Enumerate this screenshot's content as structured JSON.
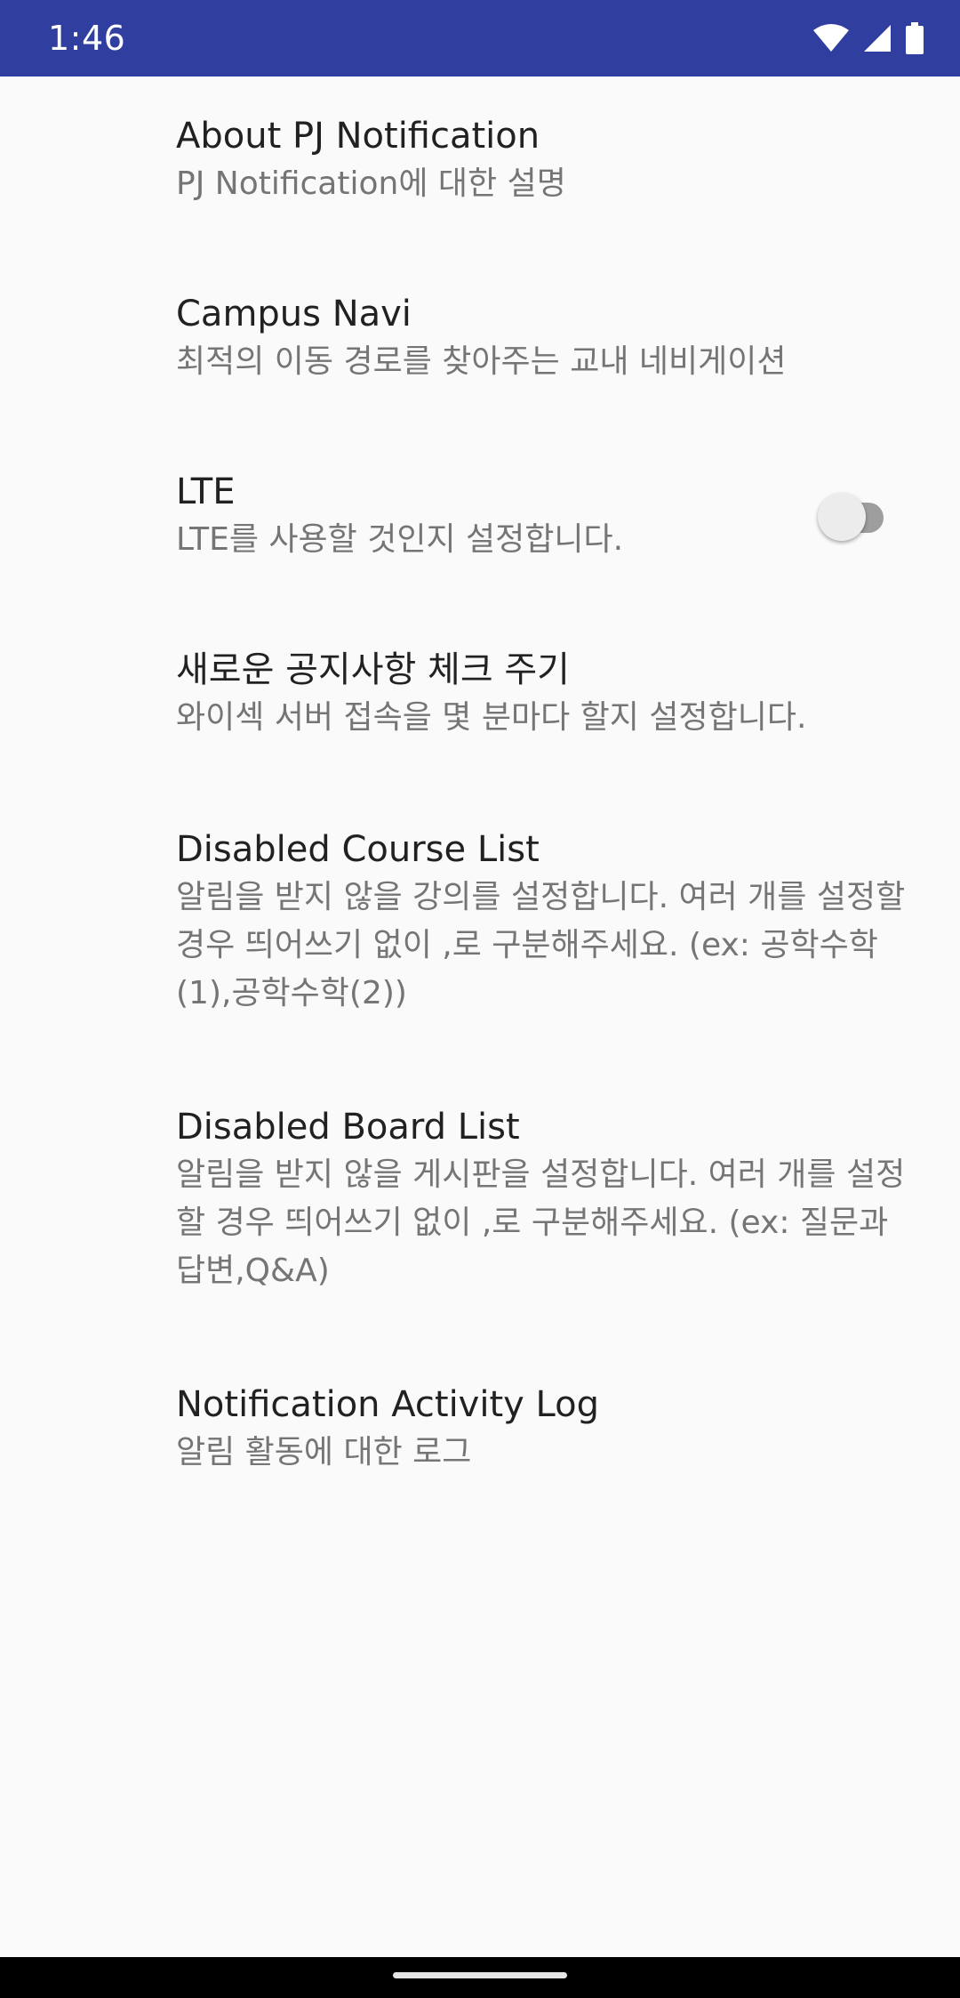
{
  "status_bar": {
    "time": "1:46",
    "icons": [
      "wifi-icon",
      "cell-signal-icon",
      "battery-icon"
    ],
    "background": "#303f9f"
  },
  "preferences": [
    {
      "title": "About PJ Notification",
      "summary": "PJ Notification에 대한 설명"
    },
    {
      "title": "Campus Navi",
      "summary": "최적의 이동 경로를 찾아주는 교내 네비게이션"
    },
    {
      "title": "LTE",
      "summary": "LTE를 사용할 것인지 설정합니다.",
      "switch_on": false
    },
    {
      "title": "새로운 공지사항 체크 주기",
      "summary": "와이섹 서버 접속을 몇 분마다 할지 설정합니다."
    },
    {
      "title": "Disabled Course List",
      "summary": "알림을 받지 않을 강의를 설정합니다. 여러 개를 설정할 경우 띄어쓰기 없이 ,로 구분해주세요. (ex: 공학수학(1),공학수학(2))"
    },
    {
      "title": "Disabled Board List",
      "summary": "알림을 받지 않을 게시판을 설정합니다. 여러 개를 설정할 경우 띄어쓰기 없이 ,로 구분해주세요. (ex: 질문과 답변,Q&A)"
    },
    {
      "title": "Notification Activity Log",
      "summary": "알림 활동에 대한 로그"
    }
  ],
  "colors": {
    "title_text": "#212121",
    "summary_text": "#757575",
    "background": "#fafafa"
  }
}
